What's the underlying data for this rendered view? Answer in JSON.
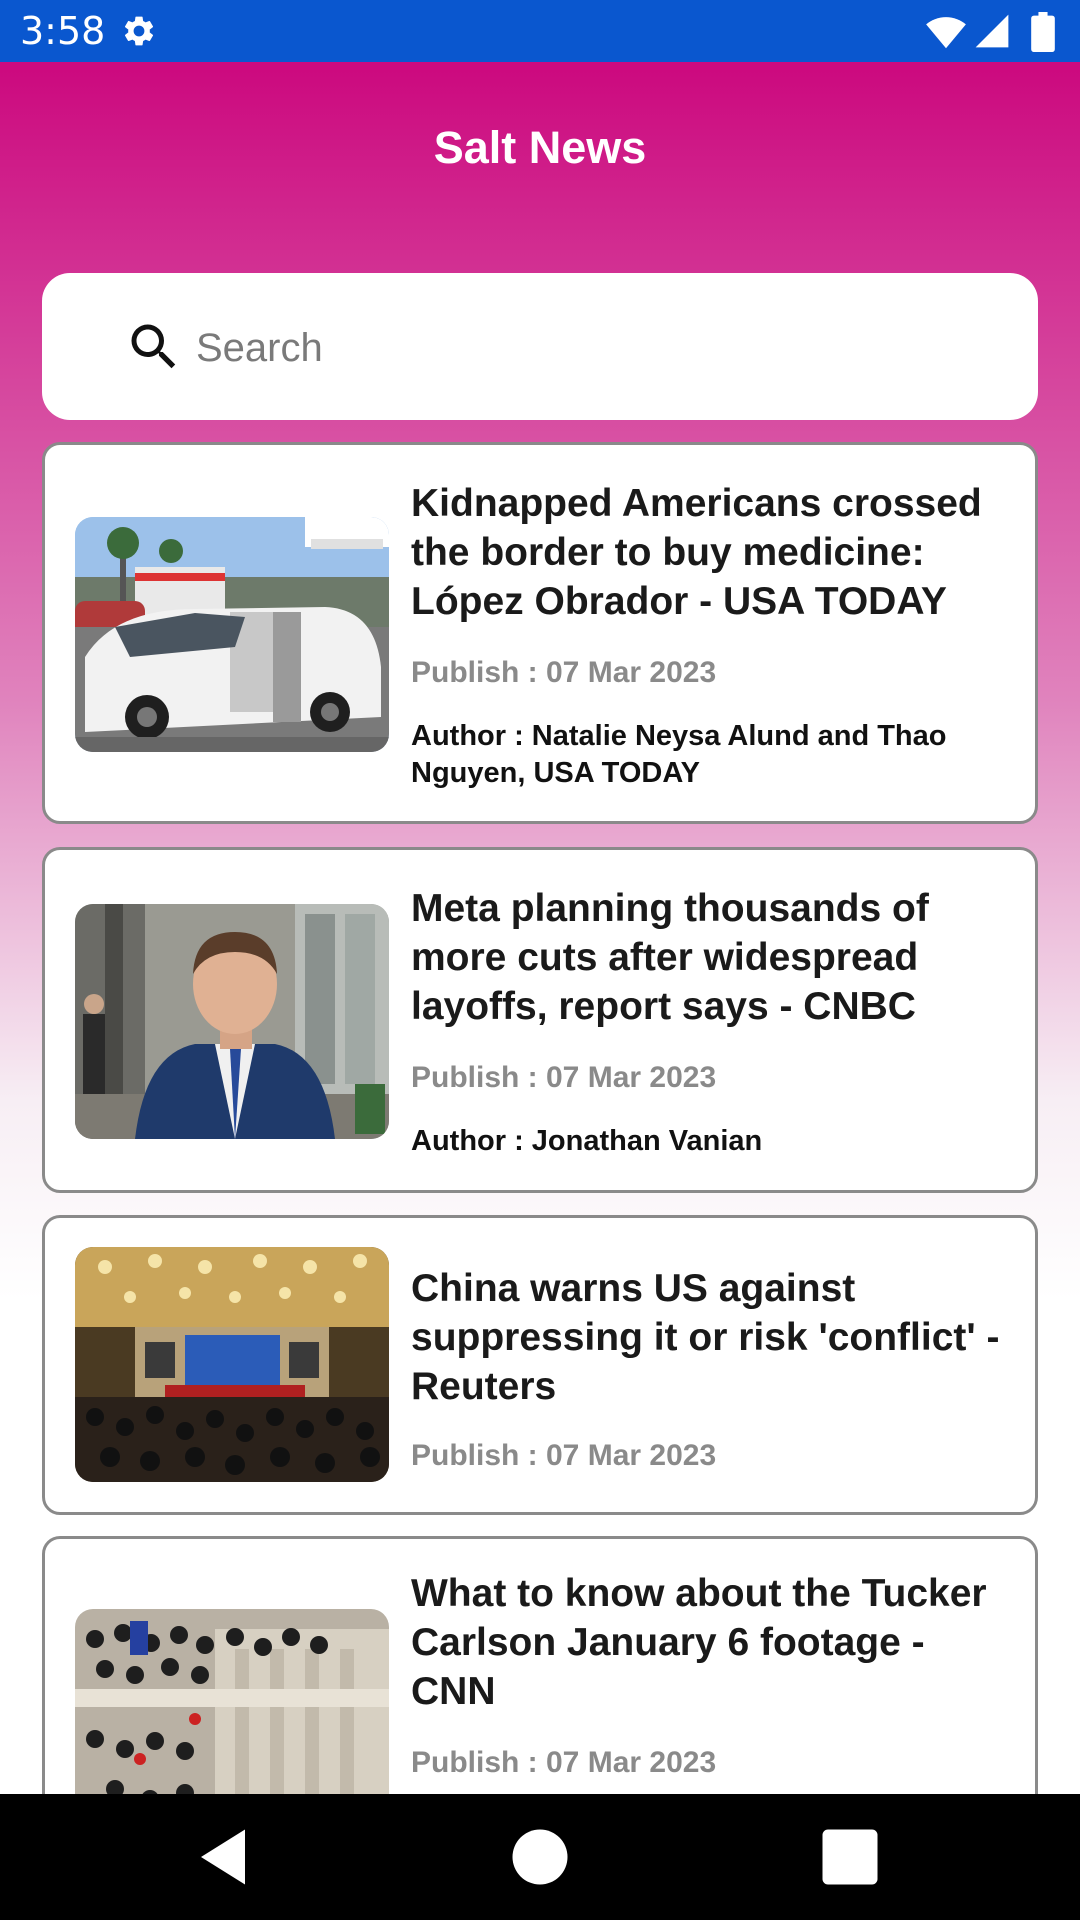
{
  "status_bar": {
    "time": "3:58",
    "icons": [
      "settings-gear-icon",
      "wifi-icon",
      "cell-signal-icon",
      "battery-icon"
    ]
  },
  "app": {
    "title": "Salt News",
    "header_color": "#cc0a7f",
    "status_bar_color": "#0a57cf"
  },
  "search": {
    "placeholder": "Search",
    "value": ""
  },
  "articles": [
    {
      "title": "Kidnapped Americans crossed the border to buy medicine: López Obrador - USA TODAY",
      "publish": "Publish : 07 Mar 2023",
      "author": "Author : Natalie Neysa Alund and Thao Nguyen, USA TODAY",
      "image": "street-scene-white-minivan"
    },
    {
      "title": "Meta planning thousands of more cuts after widespread layoffs, report says - CNBC",
      "publish": "Publish : 07 Mar 2023",
      "author": "Author : Jonathan Vanian",
      "image": "man-in-blue-suit-portrait"
    },
    {
      "title": "China warns US against suppressing it or risk 'conflict' - Reuters",
      "publish": "Publish : 07 Mar 2023",
      "author": "",
      "image": "press-conference-hall"
    },
    {
      "title": "What to know about the Tucker Carlson January 6 footage - CNN",
      "publish": "Publish : 07 Mar 2023",
      "author": "",
      "image": "crowd-at-capitol-building"
    }
  ],
  "nav_bar": {
    "icons": [
      "back-icon",
      "home-icon",
      "recents-icon"
    ]
  }
}
